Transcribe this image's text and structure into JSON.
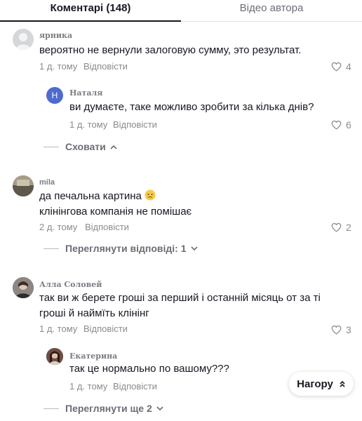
{
  "tabs": {
    "comments": "Коментарі (148)",
    "author_video": "Відео автора"
  },
  "reply_label": "Відповісти",
  "comments": [
    {
      "user": "ярника",
      "text": "вероятно не вернули залоговую сумму, это результат.",
      "time": "1 д. тому",
      "likes": "4"
    },
    {
      "user": "Наталя",
      "avatar_letter": "Н",
      "text": "ви думаєте, таке можливо зробити за кілька днів?",
      "time": "1 д. тому",
      "likes": "6"
    },
    {
      "user": "mila",
      "text_line1": "да печальна картина",
      "text_line2": "клінінгова компанія не помішає",
      "time": "2 д. тому",
      "likes": "2"
    },
    {
      "user": "Алла Соловей",
      "text_line1": "так ви ж берете гроші за перший і останній місяць от за ті",
      "text_line2": "гроші й наймїть клінінг",
      "time": "1 д. тому",
      "likes": "3"
    },
    {
      "user": "Екатерина",
      "text": "так це нормально по вашому???",
      "time": "1 д. тому"
    }
  ],
  "toggles": {
    "hide": "Сховати",
    "view_replies": "Переглянути відповіді: 1",
    "view_more": "Переглянути ще 2"
  },
  "top_button": "Нагору"
}
